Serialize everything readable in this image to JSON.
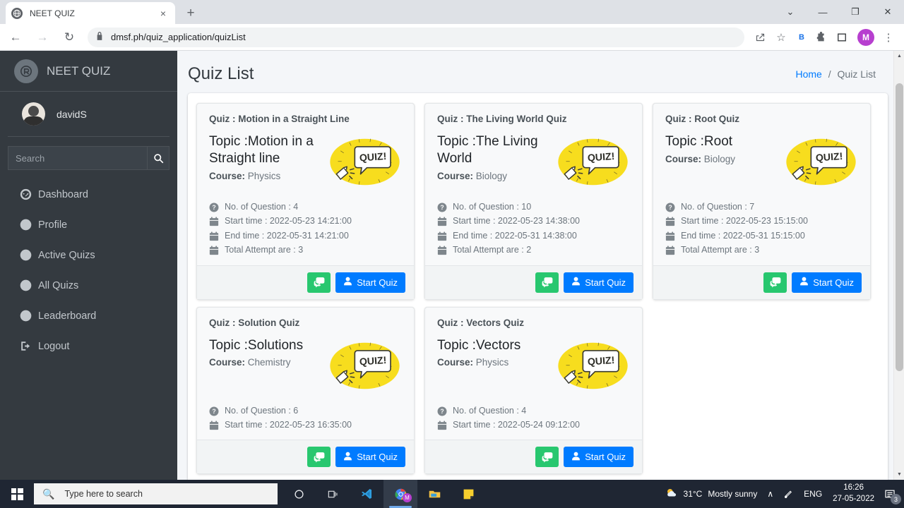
{
  "browser": {
    "tab": {
      "title": "NEET QUIZ",
      "favicon": "globe-icon",
      "close": "×"
    },
    "new_tab": "+",
    "window_controls": {
      "minimize_extra": "⌄",
      "minimize": "—",
      "maximize": "❐",
      "close": "✕"
    },
    "nav": {
      "back": "←",
      "forward": "→",
      "reload": "↻"
    },
    "omnibox": {
      "lock": "🔒",
      "url": "dmsf.ph/quiz_application/quizList"
    },
    "toolbar": {
      "share": "⤴",
      "bookmark_star": "☆",
      "bookmark_b": "B",
      "extensions": "🧩",
      "sidepanel": "▢",
      "profile_initial": "M",
      "menu": "⋮"
    }
  },
  "sidebar": {
    "brand": "NEET QUIZ",
    "brand_logo": "app-logo-icon",
    "user": {
      "name": "davidS",
      "avatar": "user-avatar"
    },
    "search": {
      "placeholder": "Search",
      "value": "",
      "button_icon": "search-icon"
    },
    "items": [
      {
        "label": "Dashboard",
        "icon": "dashboard-icon"
      },
      {
        "label": "Profile",
        "icon": "user-circle-icon"
      },
      {
        "label": "Active Quizs",
        "icon": "user-circle-icon"
      },
      {
        "label": "All Quizs",
        "icon": "user-circle-icon"
      },
      {
        "label": "Leaderboard",
        "icon": "user-circle-icon"
      },
      {
        "label": "Logout",
        "icon": "logout-icon"
      }
    ]
  },
  "header": {
    "title": "Quiz List",
    "breadcrumb": {
      "home": "Home",
      "separator": "/",
      "current": "Quiz List"
    }
  },
  "cards": [
    {
      "quiz_name": "Quiz : Motion in a Straight Line",
      "topic": "Topic :Motion in a Straight line",
      "course_label": "Course:",
      "course": "Physics",
      "thumb": "quiz-badge-icon",
      "meta": [
        {
          "icon": "question-circle-icon",
          "text": "No. of Question : 4"
        },
        {
          "icon": "calendar-icon",
          "text": "Start time : 2022-05-23 14:21:00"
        },
        {
          "icon": "calendar-icon",
          "text": "End time : 2022-05-31 14:21:00"
        },
        {
          "icon": "calendar-icon",
          "text": "Total Attempt are : 3"
        }
      ],
      "chat_button": "chat-icon",
      "start_label": "Start Quiz"
    },
    {
      "quiz_name": "Quiz : The Living World Quiz",
      "topic": "Topic :The Living World",
      "course_label": "Course:",
      "course": "Biology",
      "thumb": "quiz-badge-icon",
      "meta": [
        {
          "icon": "question-circle-icon",
          "text": "No. of Question : 10"
        },
        {
          "icon": "calendar-icon",
          "text": "Start time : 2022-05-23 14:38:00"
        },
        {
          "icon": "calendar-icon",
          "text": "End time : 2022-05-31 14:38:00"
        },
        {
          "icon": "calendar-icon",
          "text": "Total Attempt are : 2"
        }
      ],
      "chat_button": "chat-icon",
      "start_label": "Start Quiz"
    },
    {
      "quiz_name": "Quiz : Root Quiz",
      "topic": "Topic :Root",
      "course_label": "Course:",
      "course": "Biology",
      "thumb": "quiz-badge-icon",
      "meta": [
        {
          "icon": "question-circle-icon",
          "text": "No. of Question : 7"
        },
        {
          "icon": "calendar-icon",
          "text": "Start time : 2022-05-23 15:15:00"
        },
        {
          "icon": "calendar-icon",
          "text": "End time : 2022-05-31 15:15:00"
        },
        {
          "icon": "calendar-icon",
          "text": "Total Attempt are : 3"
        }
      ],
      "chat_button": "chat-icon",
      "start_label": "Start Quiz"
    },
    {
      "quiz_name": "Quiz : Solution Quiz",
      "topic": "Topic :Solutions",
      "course_label": "Course:",
      "course": "Chemistry",
      "thumb": "quiz-badge-icon",
      "meta": [
        {
          "icon": "question-circle-icon",
          "text": "No. of Question : 6"
        },
        {
          "icon": "calendar-icon",
          "text": "Start time : 2022-05-23 16:35:00"
        }
      ],
      "chat_button": "chat-icon",
      "start_label": "Start Quiz"
    },
    {
      "quiz_name": "Quiz : Vectors Quiz",
      "topic": "Topic :Vectors",
      "course_label": "Course:",
      "course": "Physics",
      "thumb": "quiz-badge-icon",
      "meta": [
        {
          "icon": "question-circle-icon",
          "text": "No. of Question : 4"
        },
        {
          "icon": "calendar-icon",
          "text": "Start time : 2022-05-24 09:12:00"
        }
      ],
      "chat_button": "chat-icon",
      "start_label": "Start Quiz"
    }
  ],
  "quiz_thumb_text": "QUIZ!",
  "taskbar": {
    "start": "windows-logo-icon",
    "search_placeholder": "Type here to search",
    "apps": [
      {
        "name": "cortana-icon"
      },
      {
        "name": "task-view-icon"
      },
      {
        "name": "vscode-icon"
      },
      {
        "name": "chrome-icon"
      },
      {
        "name": "file-explorer-icon"
      },
      {
        "name": "sticky-notes-icon"
      }
    ],
    "weather": {
      "temp": "31°C",
      "desc": "Mostly sunny"
    },
    "chevron": "∧",
    "pen": "✎",
    "language": "ENG",
    "time": "16:26",
    "date": "27-05-2022",
    "notification_count": "3"
  },
  "colors": {
    "sidebar_bg": "#343a40",
    "accent_blue": "#007bff",
    "accent_green": "#28c76f",
    "quiz_yellow": "#f7dd1e",
    "page_bg": "#f4f6f9"
  }
}
